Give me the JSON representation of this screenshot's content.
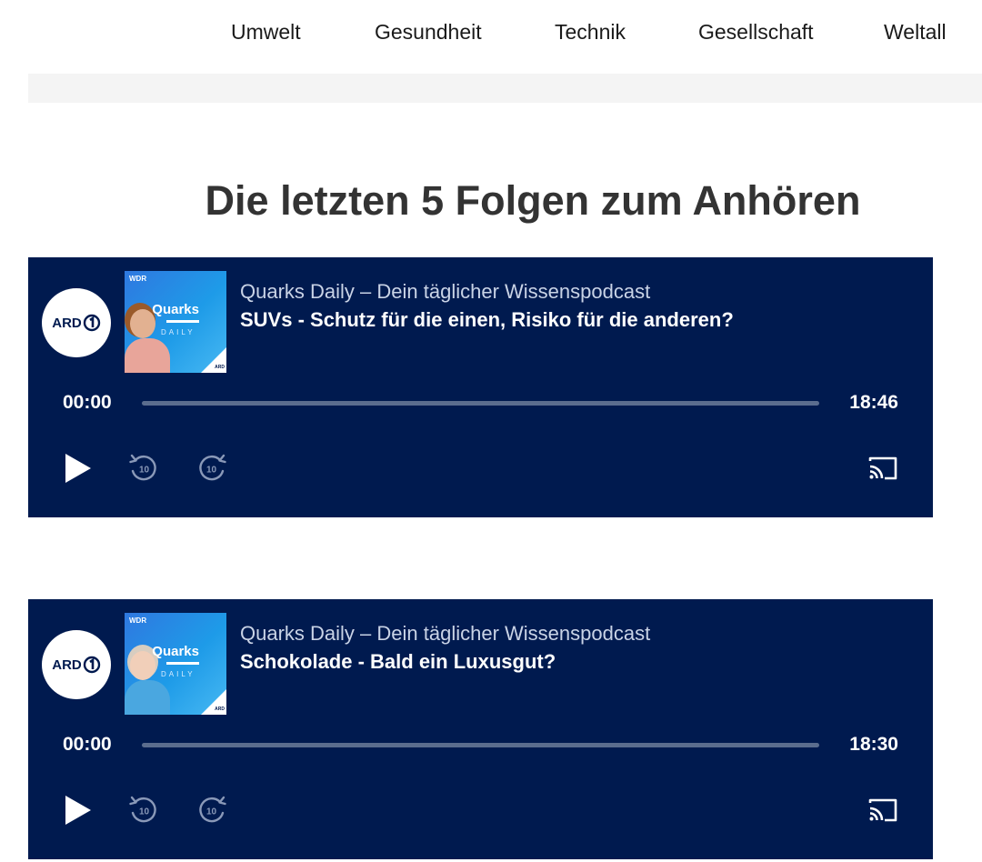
{
  "nav": {
    "items": [
      "Umwelt",
      "Gesundheit",
      "Technik",
      "Gesellschaft",
      "Weltall"
    ]
  },
  "heading": "Die letzten 5 Folgen zum Anhören",
  "brand": {
    "logo_text": "ARD",
    "cover_publisher": "WDR",
    "cover_title": "Quarks",
    "cover_subtitle": "DAILY",
    "cover_badge": "ARD"
  },
  "players": [
    {
      "podcast": "Quarks Daily – Dein täglicher Wissenspodcast",
      "title": "SUVs - Schutz für die einen, Risiko für die anderen?",
      "current_time": "00:00",
      "duration": "18:46",
      "progress": 0
    },
    {
      "podcast": "Quarks Daily – Dein täglicher Wissenspodcast",
      "title": "Schokolade - Bald ein Luxusgut?",
      "current_time": "00:00",
      "duration": "18:30",
      "progress": 0
    }
  ],
  "controls": {
    "skip_seconds": "10"
  },
  "colors": {
    "player_bg": "#001a4f",
    "accent_white": "#ffffff"
  },
  "icons": {
    "play": "play-icon",
    "rewind": "rewind-10-icon",
    "forward": "forward-10-icon",
    "cast": "cast-icon"
  }
}
